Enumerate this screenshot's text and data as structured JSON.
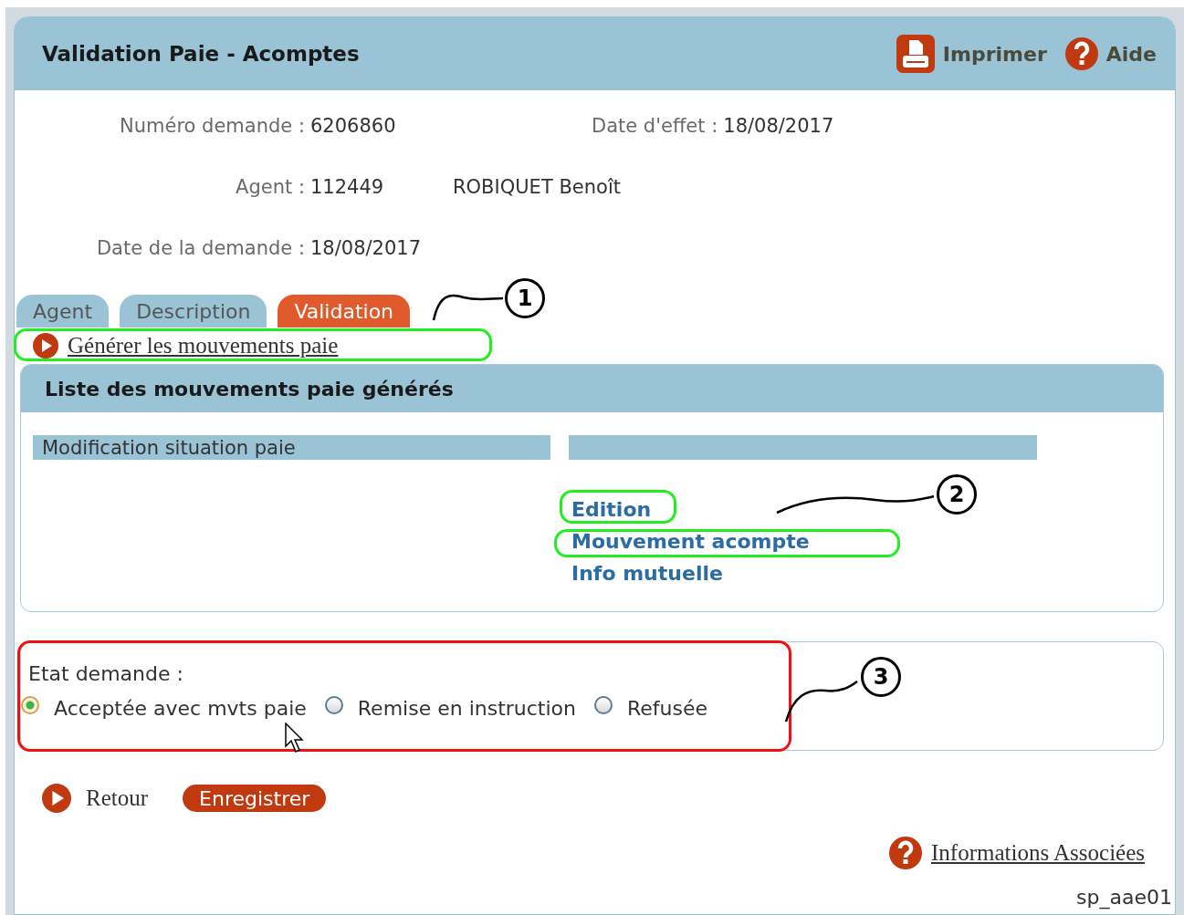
{
  "header": {
    "title": "Validation Paie - Acomptes",
    "actions": [
      {
        "kind": "print",
        "label": "Imprimer"
      },
      {
        "kind": "help",
        "label": "Aide"
      }
    ]
  },
  "info_rows": [
    [
      {
        "label": "Numéro demande :",
        "value": "6206860"
      },
      {
        "label": "Date d'effet :",
        "value": "18/08/2017"
      }
    ],
    [
      {
        "label": "Agent :",
        "value": "112449"
      },
      {
        "value": "ROBIQUET Benoît"
      }
    ],
    [
      {
        "label": "Date de la demande :",
        "value": "18/08/2017"
      }
    ]
  ],
  "tabs": [
    {
      "label": "Agent",
      "selected": false
    },
    {
      "label": "Description",
      "selected": false
    },
    {
      "label": "Validation",
      "selected": true
    }
  ],
  "generate_link": "Générer les mouvements paie",
  "movements_panel": {
    "title": "Liste des mouvements paie générés",
    "columns": [
      "Modification situation paie"
    ],
    "links": [
      "Edition",
      "Mouvement acompte",
      "Info mutuelle"
    ]
  },
  "state": {
    "label": "Etat demande :",
    "options": [
      {
        "label": "Acceptée avec mvts paie",
        "selected": true
      },
      {
        "label": "Remise en instruction",
        "selected": false
      },
      {
        "label": "Refusée",
        "selected": false
      }
    ]
  },
  "back_link": "Retour",
  "save_button": "Enregistrer",
  "related_link": "Informations Associées",
  "screen_code": "sp_aae01",
  "callouts": [
    "1",
    "2",
    "3"
  ]
}
